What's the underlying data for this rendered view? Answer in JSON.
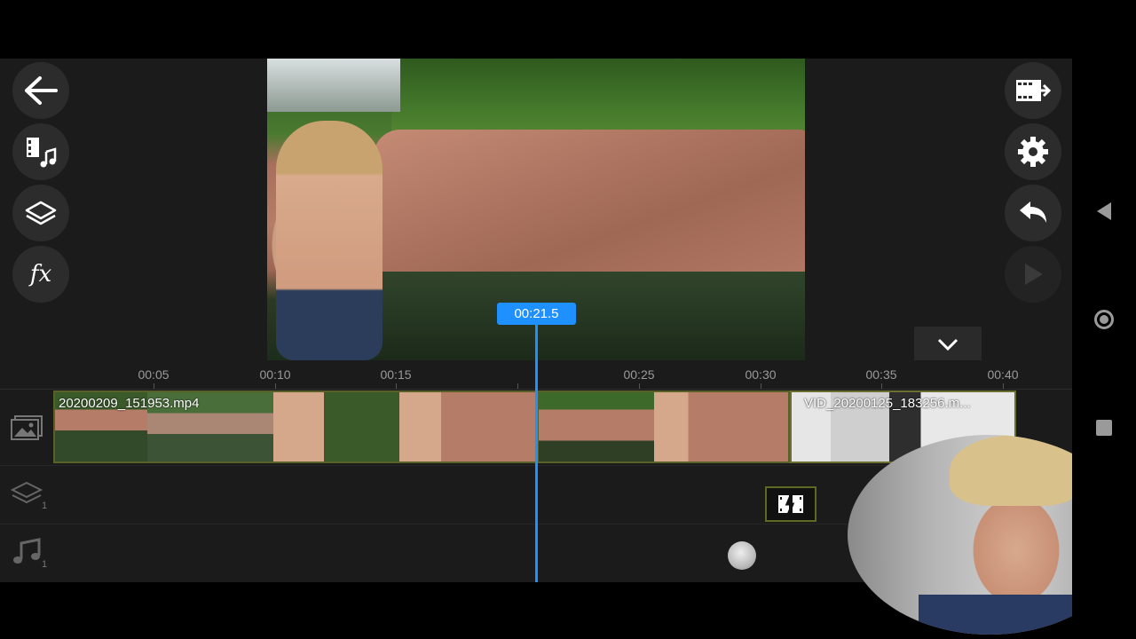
{
  "app": {
    "tools_left": [
      {
        "name": "back-arrow-icon"
      },
      {
        "name": "media-music-icon"
      },
      {
        "name": "layers-icon"
      },
      {
        "name": "fx-icon",
        "label": "fx"
      }
    ],
    "tools_right": [
      {
        "name": "export-icon"
      },
      {
        "name": "settings-gear-icon"
      },
      {
        "name": "undo-icon"
      },
      {
        "name": "play-icon"
      }
    ]
  },
  "timeline": {
    "ticks": [
      "00:05",
      "00:10",
      "00:15",
      "00:25",
      "00:30",
      "00:35",
      "00:40"
    ],
    "playhead_time": "00:21.5",
    "clips": [
      {
        "name": "20200209_151953.mp4"
      },
      {
        "name": "VID_20200125_183256.m..."
      }
    ],
    "layer_track_count": "1",
    "audio_track_count": "1"
  },
  "colors": {
    "accent": "#1e90ff",
    "clip_border": "#59602a",
    "background": "#1b1b1b"
  }
}
